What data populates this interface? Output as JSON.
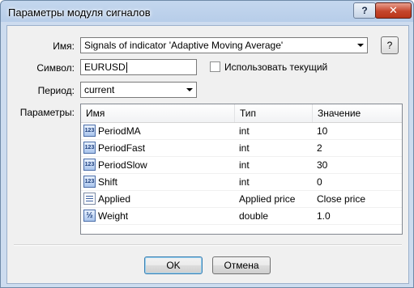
{
  "window": {
    "title": "Параметры модуля сигналов",
    "help_label": "?",
    "close_label": "✕"
  },
  "form": {
    "name_label": "Имя:",
    "name_value": "Signals of indicator 'Adaptive Moving Average'",
    "name_help_label": "?",
    "symbol_label": "Символ:",
    "symbol_value": "EURUSD",
    "use_current_label": "Использовать текущий",
    "period_label": "Период:",
    "period_value": "current",
    "params_label": "Параметры:"
  },
  "table": {
    "columns": [
      "Имя",
      "Тип",
      "Значение"
    ],
    "rows": [
      {
        "icon": "integer-icon",
        "name": "PeriodMA",
        "type": "int",
        "value": "10"
      },
      {
        "icon": "integer-icon",
        "name": "PeriodFast",
        "type": "int",
        "value": "2"
      },
      {
        "icon": "integer-icon",
        "name": "PeriodSlow",
        "type": "int",
        "value": "30"
      },
      {
        "icon": "integer-icon",
        "name": "Shift",
        "type": "int",
        "value": "0"
      },
      {
        "icon": "enum-list-icon",
        "name": "Applied",
        "type": "Applied price",
        "value": "Close price"
      },
      {
        "icon": "fraction-icon",
        "name": "Weight",
        "type": "double",
        "value": "1.0"
      }
    ]
  },
  "buttons": {
    "ok": "OK",
    "cancel": "Отмена"
  },
  "icon_glyphs": {
    "integer": "123",
    "fraction": "½"
  }
}
